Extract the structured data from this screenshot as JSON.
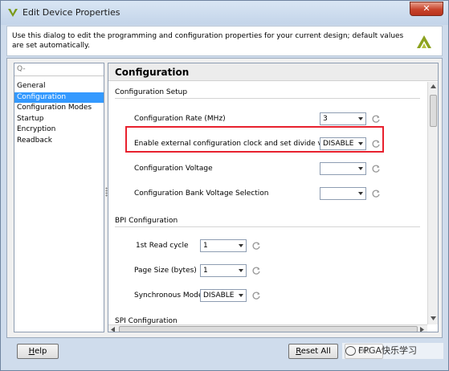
{
  "window": {
    "title": "Edit Device Properties",
    "close_label": "✕"
  },
  "description": "Use this dialog to edit the programming and configuration properties for your current design; default values are set automatically.",
  "search": {
    "placeholder": "Q-"
  },
  "nav": {
    "items": [
      {
        "label": "General",
        "selected": false
      },
      {
        "label": "Configuration",
        "selected": true
      },
      {
        "label": "Configuration Modes",
        "selected": false
      },
      {
        "label": "Startup",
        "selected": false
      },
      {
        "label": "Encryption",
        "selected": false
      },
      {
        "label": "Readback",
        "selected": false
      }
    ]
  },
  "panel": {
    "title": "Configuration",
    "setup": {
      "title": "Configuration Setup",
      "rows": [
        {
          "label": "Configuration Rate (MHz)",
          "value": "3"
        },
        {
          "label": "Enable external configuration clock and set divide value",
          "value": "DISABLE"
        },
        {
          "label": "Configuration Voltage",
          "value": ""
        },
        {
          "label": "Configuration Bank Voltage Selection",
          "value": ""
        }
      ]
    },
    "bpi": {
      "title": "BPI Configuration",
      "rows": [
        {
          "label": "1st Read cycle",
          "value": "1"
        },
        {
          "label": "Page Size (bytes)",
          "value": "1"
        },
        {
          "label": "Synchronous Mode",
          "value": "DISABLE"
        }
      ]
    },
    "spi": {
      "title": "SPI Configuration"
    }
  },
  "buttons": {
    "help_prefix": "",
    "help_key": "H",
    "help_rest": "elp",
    "reset_prefix": "",
    "reset_key": "R",
    "reset_rest": "eset All",
    "ok_label": "OK"
  },
  "watermark": "FPGA快乐学习",
  "colors": {
    "highlight": "#e8212e",
    "selection": "#3399ff"
  }
}
